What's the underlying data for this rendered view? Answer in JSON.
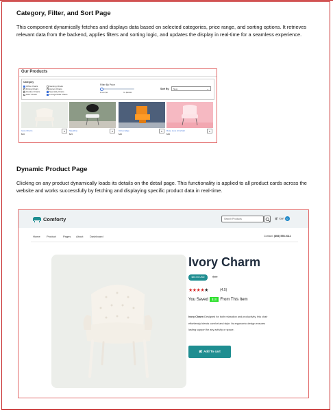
{
  "section1": {
    "heading": "Category, Filter, and Sort Page",
    "body": "This component dynamically fetches and displays data based on selected categories, price range, and sorting options. It retrieves relevant data from the backend, applies filters and sorting logic, and updates the display in real-time for a seamless experience."
  },
  "products_page": {
    "title": "Our Products",
    "category_heading": "Category",
    "categories": [
      {
        "label": "Office Chairs",
        "checked": true
      },
      {
        "label": "Dining Chairs",
        "checked": false
      },
      {
        "label": "Outdoor Chairs",
        "checked": false
      },
      {
        "label": "Kids' Chairs",
        "checked": false
      },
      {
        "label": "Gaming Chairs",
        "checked": false
      },
      {
        "label": "Accent Chairs",
        "checked": false
      },
      {
        "label": "Specialty Chairs",
        "checked": true
      },
      {
        "label": "Lounge/Sofa Chairs",
        "checked": true
      }
    ],
    "price_filter_heading": "Filter By Price",
    "price_min": "From $0",
    "price_max": "To $3000",
    "price_level": 0,
    "sort_label": "Sort By",
    "sort_value": "New",
    "products": [
      {
        "name": "Ivory Charm",
        "price": "$30",
        "button": "★",
        "color": "#e8ebe6"
      },
      {
        "name": "Sleekline",
        "price": "$45",
        "button": "★",
        "color": "#8f9c8a"
      },
      {
        "name": "Citrus Edge",
        "price": "$40",
        "button": "★",
        "color": "#5a6a82"
      },
      {
        "name": "Rose Luxe Armchair",
        "price": "$35",
        "button": "★",
        "color": "#f3b7c0"
      }
    ]
  },
  "section2": {
    "heading": "Dynamic Product Page",
    "body": "Clicking on any product dynamically loads its details on the detail page. This functionality is applied to all product cards across the website and works successfully by fetching and displaying specific product data in real-time."
  },
  "detail_page": {
    "brand": "Comforty",
    "search_placeholder": "Search Products",
    "cart_label": "Cart",
    "cart_count": "0",
    "nav": [
      "Home",
      "Product",
      "Pages",
      "About",
      "Dashboard"
    ],
    "contact_label": "Contact:",
    "contact_number": "(808) 555-0111",
    "product_title": "Ivory Charm",
    "current_price": "$20.00 USD",
    "old_price": "$30",
    "rating_text": "(4.5)",
    "saved_prefix": "You Saved",
    "saved_amount": "$10",
    "saved_suffix": "From This Item",
    "description_name": "Ivory Charm",
    "description_rest": "Designed for both relaxation and productivity, this chair effortlessly blends comfort and style. Its ergonomic design ensures lasting support for any activity or space.",
    "add_to_cart": "Add To cart",
    "colors": {
      "teal": "#1f8e91",
      "star": "#d62828",
      "saved": "#2ee02e",
      "badge": "#1e88c8"
    }
  }
}
